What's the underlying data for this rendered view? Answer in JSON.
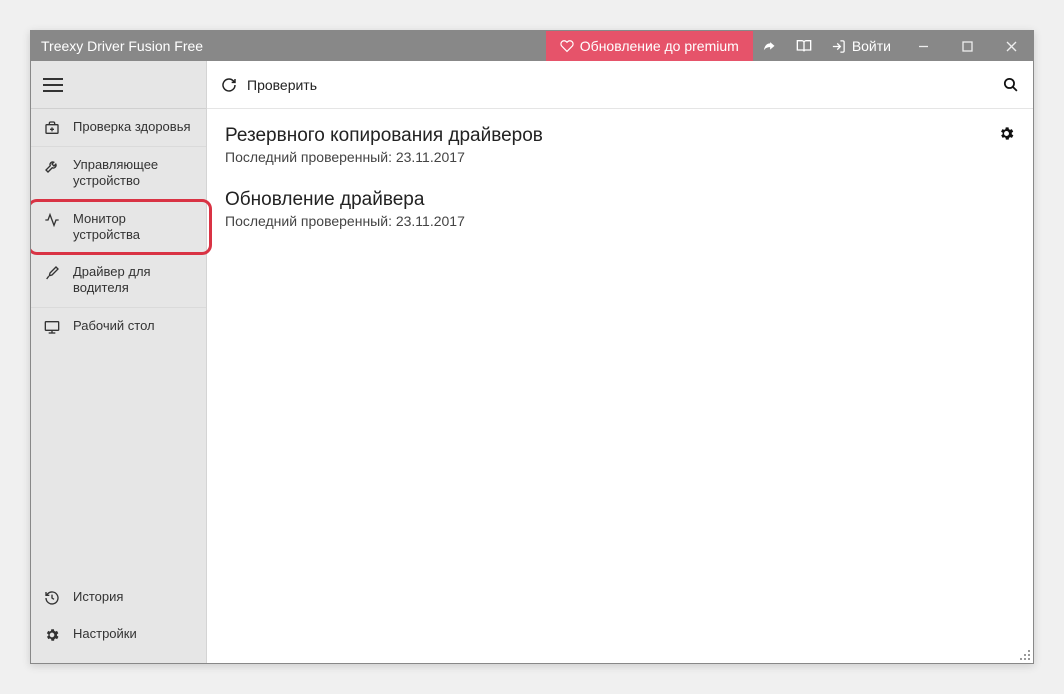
{
  "titlebar": {
    "title": "Treexy Driver Fusion Free",
    "premium_label": "Обновление до premium",
    "login_label": "Войти"
  },
  "sidebar": {
    "items": [
      {
        "label": "Проверка здоровья"
      },
      {
        "label": "Управляющее устройство"
      },
      {
        "label": "Монитор устройства"
      },
      {
        "label": "Драйвер для водителя"
      },
      {
        "label": "Рабочий стол"
      }
    ],
    "bottom": [
      {
        "label": "История"
      },
      {
        "label": "Настройки"
      }
    ]
  },
  "toolbar": {
    "check_label": "Проверить"
  },
  "sections": [
    {
      "title": "Резервного копирования драйверов",
      "sub": "Последний проверенный: 23.11.2017"
    },
    {
      "title": "Обновление драйвера",
      "sub": "Последний проверенный: 23.11.2017"
    }
  ]
}
